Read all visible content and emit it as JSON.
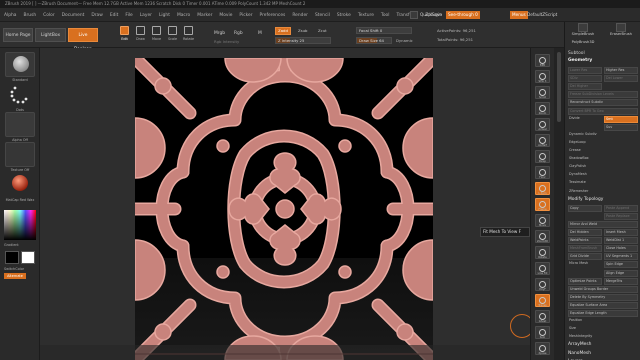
{
  "title_bar": {
    "text": "ZBrush 2019 [ ]     —ZBrush Document—     Free Mem 12.7GB  Active Mem 1236  Scratch Disk 0  Timer 0.001  ATime 0.009   PolyCount 1.342 MP   MeshCount 2"
  },
  "menu_bar": {
    "items": [
      "Alpha",
      "Brush",
      "Color",
      "Document",
      "Draw",
      "Edit",
      "File",
      "Layer",
      "Light",
      "Macro",
      "Marker",
      "Movie",
      "Picker",
      "Preferences",
      "Render",
      "Stencil",
      "Stroke",
      "Texture",
      "Tool",
      "Transform",
      "Zplugin",
      "Zscript"
    ],
    "quicksave": "QuickSave",
    "see_through": "See-through 0",
    "menus_toggle": "Menus",
    "default_script": "DefaultZScript"
  },
  "shelf": {
    "home": "Home Page",
    "lightbox": "LightBox",
    "live_boolean": "Live Boolean",
    "edit": "Edit",
    "draw": "Draw",
    "move": "Move",
    "scale": "Scale",
    "rotate": "Rotate",
    "mrgb": "Mrgb",
    "rgb": "Rgb",
    "m": "M",
    "zadd": "Zadd",
    "zsub": "Zsub",
    "zcut": "Zcut",
    "rgb_intensity": "Rgb Intensity",
    "z_intensity": "Z Intensity 25",
    "focal_shift": "Focal Shift 0",
    "draw_size": "Draw Size 64",
    "dynamic": "Dynamic",
    "active_points": "ActivePoints: 96,251",
    "total_points": "TotalPoints: 96,251"
  },
  "left_tray": {
    "items": [
      "Standard",
      "Dots",
      "Alpha Off",
      "Texture Off",
      "MatCap Red Wax"
    ],
    "gradient": "Gradient",
    "switch_color": "SwitchColor",
    "alternate": "Alternate"
  },
  "viewport": {
    "tooltip": "Fit Mesh To View  F"
  },
  "right_icons": [
    "BPR",
    "SPix 3",
    "Scroll",
    "Zoom",
    "Actual",
    "AAHalf",
    "Persp",
    "Floor",
    "L.Sym",
    "Frame",
    "Move",
    "Zoom3D",
    "Rotate",
    "Line Fill",
    "PolyF",
    "Transp",
    "Ghost",
    "Solo",
    "Xpose"
  ],
  "colors": {
    "accent": "#d9701f",
    "tile": "#c8837c",
    "tile_edge": "#e7a89f",
    "tile_dark": "#8b4c45",
    "background": "#262626",
    "void": "#000000"
  },
  "panel": {
    "thumbs": [
      "SimpleBrush",
      "EraserBrush",
      "PolyBrush3D"
    ],
    "subtool": "Subtool",
    "geometry": "Geometry",
    "lower_res": "Lower Res",
    "higher_res": "Higher Res",
    "sdiv": "SDiv",
    "del_lower": "Del Lower",
    "del_higher": "Del Higher",
    "freeze": "Freeze SubDivision Levels",
    "reconstruct": "Reconstruct Subdiv",
    "convert": "Convert BPR To Geo",
    "divide": "Divide",
    "smt": "Smt",
    "suv": "Suv",
    "dynamic_subdiv": "Dynamic Subdiv",
    "edgeloop": "EdgeLoop",
    "crease": "Crease",
    "shadowbox": "ShadowBox",
    "claypolish": "ClayPolish",
    "dynamesh": "DynaMesh",
    "tessimate": "Tessimate",
    "zremesher": "ZRemesher",
    "modify_topology": "Modify Topology",
    "copy": "Copy",
    "paste_append": "Paste Append",
    "paste_replace": "Paste Replace",
    "mirror_weld": "Mirror And Weld",
    "del_hidden": "Del Hidden",
    "insert_mesh": "Insert Mesh",
    "weld_points": "WeldPoints",
    "weld_dist": "WeldDist 1",
    "mesh_from_brush": "MeshFromBrush",
    "close_holes": "Close Holes",
    "grid_divide": "Grid Divide",
    "uv_segments": "UV Segments 1",
    "micro_mesh": "Micro Mesh",
    "spin_edge": "Spin Edge",
    "align_edge": "Align Edge",
    "optimize_points": "Optimize Points",
    "merge_tris": "MergeTris",
    "unweld_groups_border": "Unweld Groups Border",
    "delete_by_symmetry": "Delete By Symmetry",
    "equalize_surface_area": "Equalize Surface Area",
    "equalize_edge_length": "Equalize Edge Length",
    "position": "Position",
    "size": "Size",
    "meshintegrity": "MeshIntegrity",
    "arraymesh": "ArrayMesh",
    "nanomesh": "NanoMesh",
    "layers": "Layers",
    "fibermesh": "FiberMesh"
  }
}
